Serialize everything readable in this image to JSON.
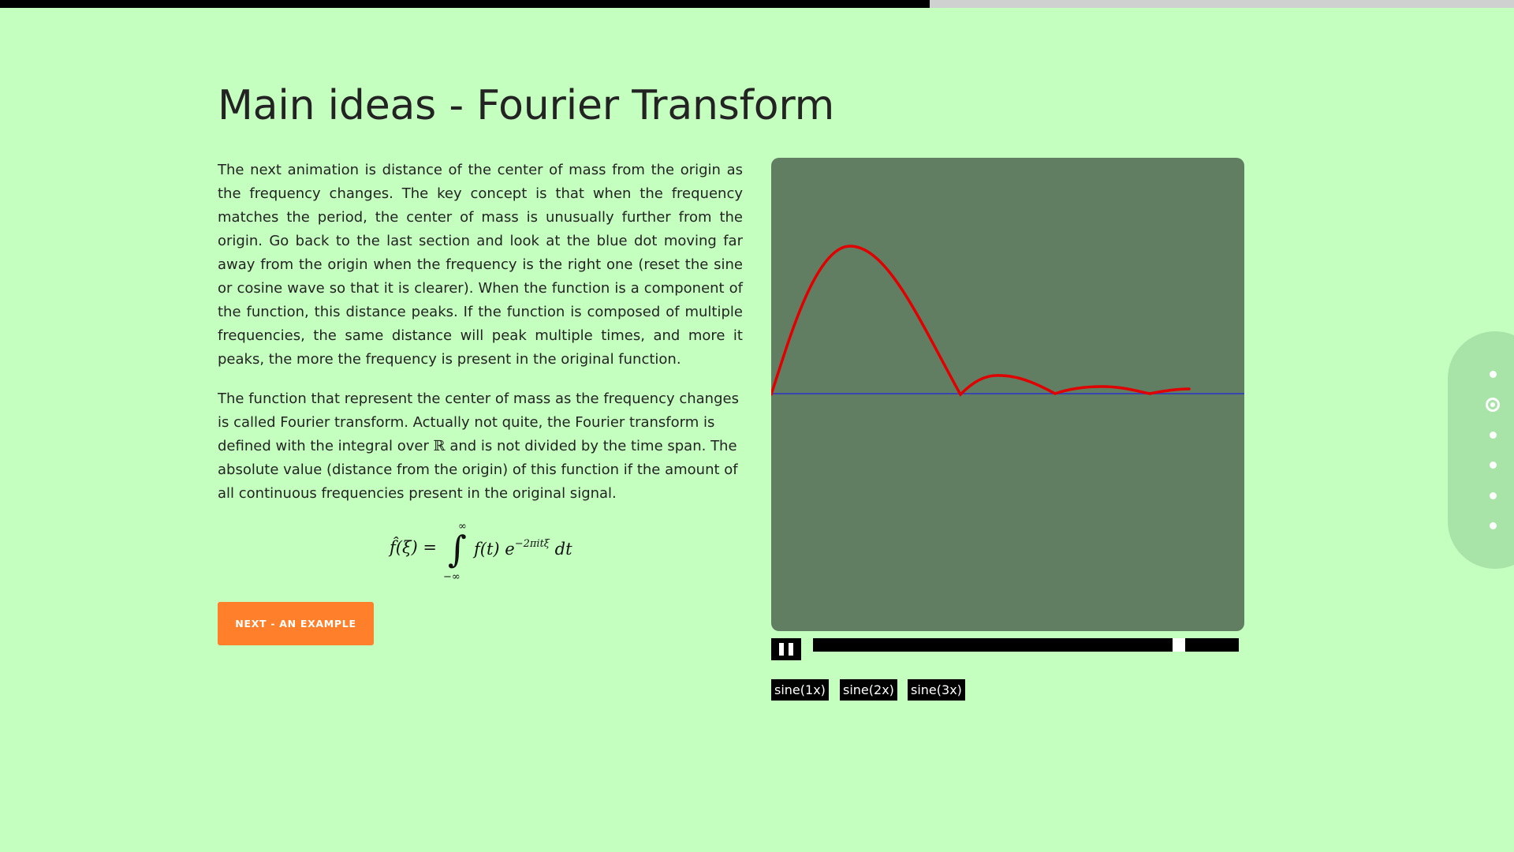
{
  "progress": {
    "fraction": 0.614
  },
  "title": "Main ideas - Fourier Transform",
  "paragraphs": {
    "p1": "The next animation is distance of the center of mass from the origin as the frequency changes. The key concept is that when the frequency matches the period, the center of mass is unusually further from the origin. Go back to the last section and look at the blue dot moving far away from the origin when the frequency is the right one (reset the sine or cosine wave so that it is clearer). When the function is a component of the function, this distance peaks. If the function is composed of multiple frequencies, the same distance will peak multiple times, and more it peaks, the more the frequency is present in the original function.",
    "p2_before": "The function that represent the center of mass as the frequency changes is called Fourier transform. Actually not quite, the Fourier transform is defined with the integral over ",
    "p2_symbol": "ℝ",
    "p2_after": " and is not divided by the time span. The absolute value (distance from the origin) of this function if the amount of all continuous frequencies present in the original signal."
  },
  "formula": {
    "lhs": "f̂(ξ) =",
    "integral": "∫",
    "upper_limit": "∞",
    "lower_limit": "−∞",
    "integrand": "f(t) e",
    "exponent": "−2πitξ",
    "differential": "dt"
  },
  "next_button": {
    "label": "NEXT - AN EXAMPLE"
  },
  "animation": {
    "background_color": "#627e62",
    "curve_color": "#e00000",
    "axis_color": "#3a46b0",
    "playing": true,
    "timeline_position": 0.87
  },
  "wave_buttons": [
    "sine(1x)",
    "sine(2x)",
    "sine(3x)"
  ],
  "slide_nav": {
    "count": 6,
    "active_index": 1
  }
}
